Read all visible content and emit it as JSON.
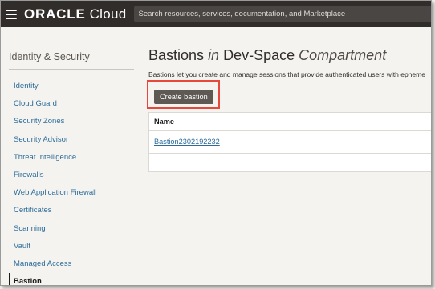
{
  "header": {
    "brand_oracle": "ORACLE",
    "brand_cloud": "Cloud",
    "search_placeholder": "Search resources, services, documentation, and Marketplace"
  },
  "sidebar": {
    "title": "Identity & Security",
    "items": [
      {
        "label": "Identity"
      },
      {
        "label": "Cloud Guard"
      },
      {
        "label": "Security Zones"
      },
      {
        "label": "Security Advisor"
      },
      {
        "label": "Threat Intelligence"
      },
      {
        "label": "Firewalls"
      },
      {
        "label": "Web Application Firewall"
      },
      {
        "label": "Certificates"
      },
      {
        "label": "Scanning"
      },
      {
        "label": "Vault"
      },
      {
        "label": "Managed Access"
      },
      {
        "label": "Bastion",
        "active": true
      }
    ]
  },
  "main": {
    "title_resource": "Bastions",
    "title_in": "in",
    "title_compartment": "Dev-Space",
    "title_suffix": "Compartment",
    "description": "Bastions let you create and manage sessions that provide authenticated users with epheme",
    "create_button": "Create bastion",
    "table": {
      "columns": [
        "Name"
      ],
      "rows": [
        {
          "name": "Bastion2302192232"
        }
      ]
    }
  },
  "colors": {
    "header_bg": "#312d2a",
    "link": "#2c6c9a",
    "highlight": "#e8473b",
    "button_bg": "#5f5954"
  }
}
